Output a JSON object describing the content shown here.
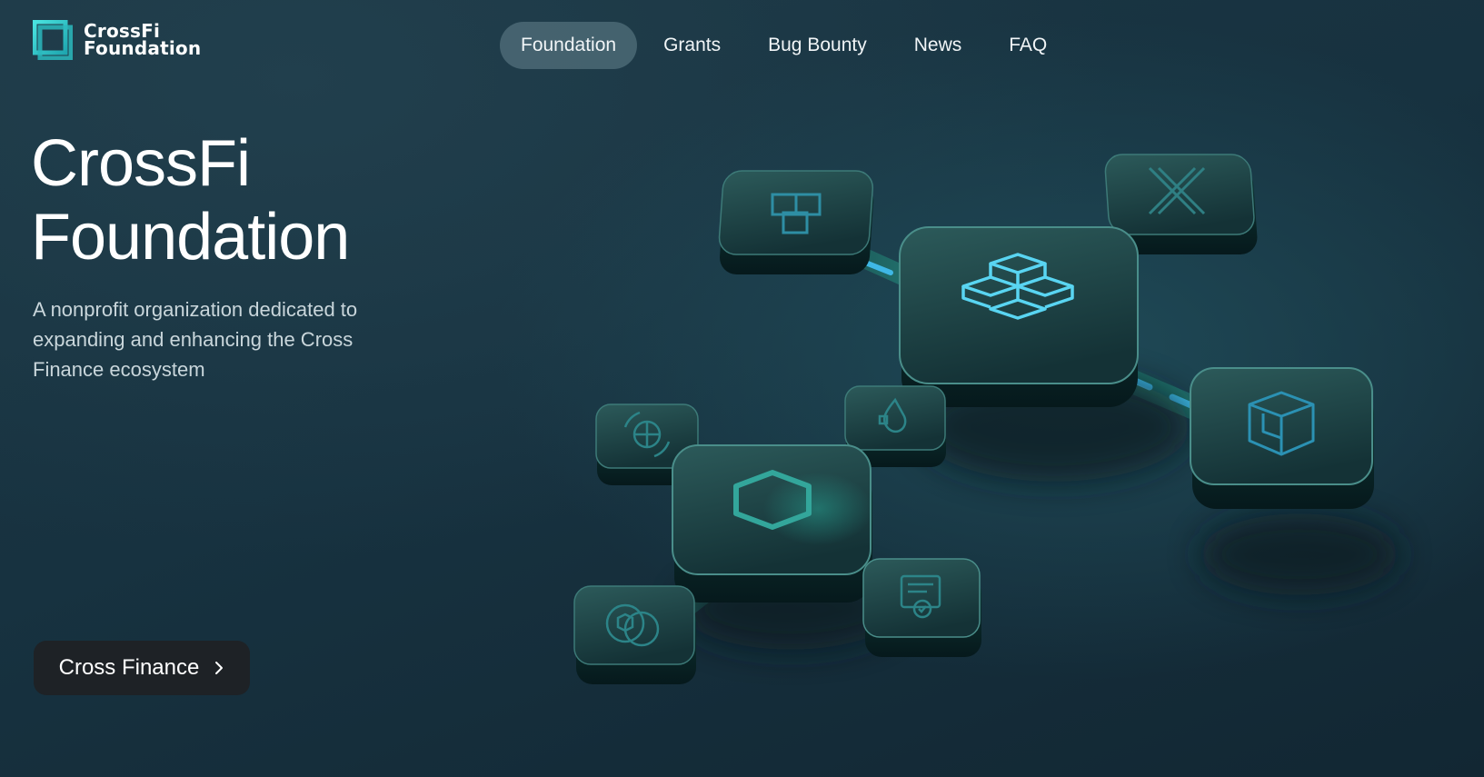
{
  "header": {
    "logo": {
      "line1": "CrossFi",
      "line2": "Foundation",
      "icon": "crossfi-square-logo-icon"
    },
    "nav": [
      {
        "label": "Foundation",
        "active": true
      },
      {
        "label": "Grants",
        "active": false
      },
      {
        "label": "Bug Bounty",
        "active": false
      },
      {
        "label": "News",
        "active": false
      },
      {
        "label": "FAQ",
        "active": false
      }
    ]
  },
  "hero": {
    "title_line1": "CrossFi",
    "title_line2": "Foundation",
    "subtitle": "A nonprofit organization dedicated to expanding and enhancing the Cross Finance ecosystem",
    "cta_label": "Cross Finance",
    "cta_icon": "chevron-right-icon"
  },
  "illustration": {
    "tiles": [
      "crossfi-cube-icon",
      "cube-stack-icon",
      "x-cross-icon",
      "grid-cube-icon",
      "droplet-icon",
      "globe-arrows-icon",
      "square-frame-icon",
      "coin-cube-icon",
      "document-check-icon"
    ]
  },
  "colors": {
    "background": "#173240",
    "accent": "#2ec4c4",
    "nav_active_bg": "#4f6a74",
    "cta_bg": "#1e2226",
    "subtitle": "#c9d6db"
  }
}
